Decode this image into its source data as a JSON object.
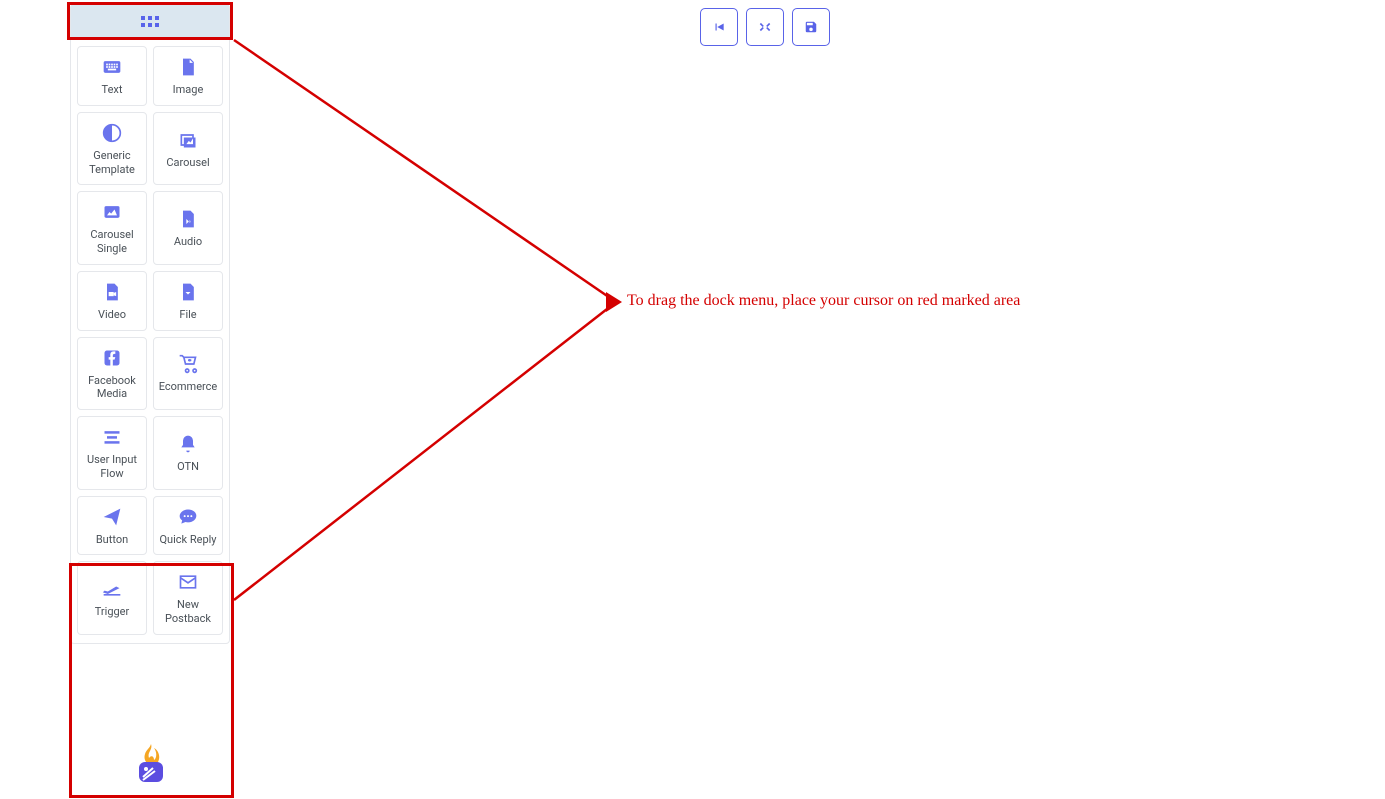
{
  "annotation": "To drag the dock menu, place your cursor on red marked area",
  "dock_items": [
    {
      "label": "Text"
    },
    {
      "label": "Image"
    },
    {
      "label": "Generic Template"
    },
    {
      "label": "Carousel"
    },
    {
      "label": "Carousel Single"
    },
    {
      "label": "Audio"
    },
    {
      "label": "Video"
    },
    {
      "label": "File"
    },
    {
      "label": "Facebook Media"
    },
    {
      "label": "Ecommerce"
    },
    {
      "label": "User Input Flow"
    },
    {
      "label": "OTN"
    },
    {
      "label": "Button"
    },
    {
      "label": "Quick Reply"
    },
    {
      "label": "Trigger"
    },
    {
      "label": "New Postback"
    }
  ],
  "toolbar": {
    "back": "",
    "arrange": "",
    "save": ""
  }
}
